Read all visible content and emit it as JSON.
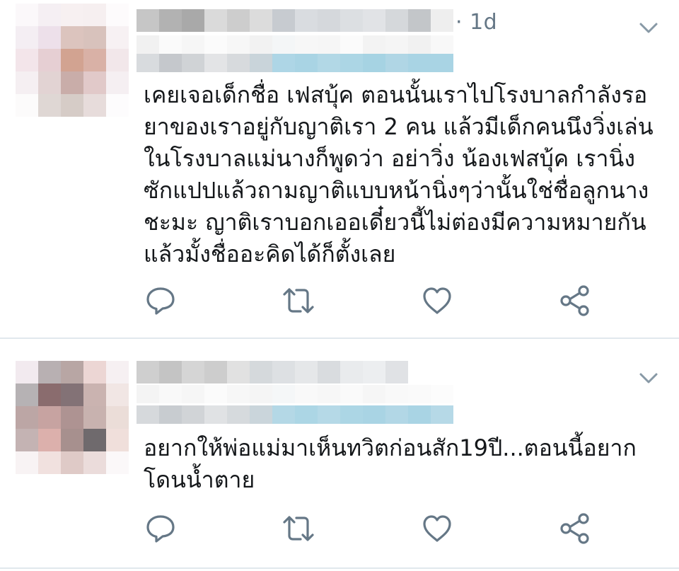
{
  "colors": {
    "icon_gray": "#657786",
    "text": "#14171a",
    "divider": "#e1e8ed",
    "handle_blur_blue": "#a9d4e4"
  },
  "tweets": [
    {
      "time": "· 1d",
      "text": "เคยเจอเด็กชื่อ เฟสบุ้ค ตอนนั้นเราไปโรงบาลกำลังรอ\nยาของเราอยู่กับญาติเรา 2 คน แล้วมีเด็กคนนึงวิ่งเล่น\nในโรงบาลแม่นางก็พูดว่า อย่าวิ่ง น้องเฟสบุ้ค เรานิ่ง\nซักแปปแล้วถามญาติแบบหน้านิ่งๆว่านั้นใช่ชื่อลูกนาง\nชะมะ ญาติเราบอกเออเดี๋ยวนี้ไม่ต่องมีความหมายกัน\nแล้วมั้งชื่ออะคิดได้ก็ตั้งเลย",
      "icons": [
        "reply-icon",
        "retweet-icon",
        "like-icon",
        "share-icon"
      ]
    },
    {
      "time": "",
      "text": "อยากให้พ่อแม่มาเห็นทวิตก่อนสัก19ปี...ตอนนี้อยาก\nโดนน้ำตาย",
      "icons": [
        "reply-icon",
        "retweet-icon",
        "like-icon",
        "share-icon"
      ]
    }
  ]
}
